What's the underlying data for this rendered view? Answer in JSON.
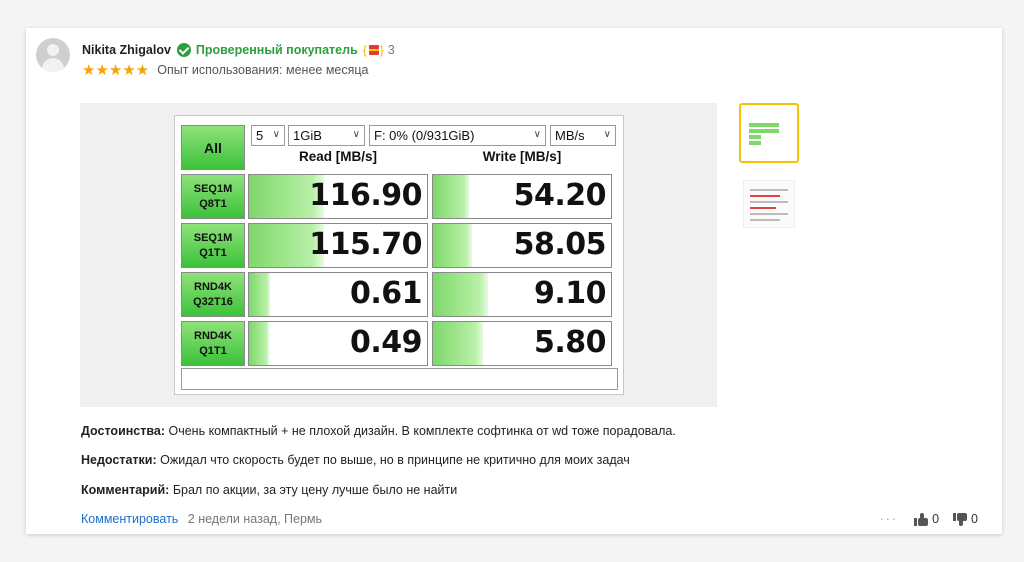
{
  "review": {
    "author": "Nikita Zhigalov",
    "verified_label": "Проверенный покупатель",
    "badge_count": "3",
    "stars": "★★★★★",
    "experience": "Опыт использования: менее месяца",
    "pros_label": "Достоинства:",
    "pros_text": "Очень компактный + не плохой дизайн. В комплекте софтинка от wd тоже порадовала.",
    "cons_label": "Недостатки:",
    "cons_text": "Ожидал что скорость будет по выше, но в принципе не критично для моих задач",
    "comment_label": "Комментарий:",
    "comment_text": "Брал по акции, за эту цену лучше было не найти",
    "comment_link": "Комментировать",
    "meta": "2 недели назад, Пермь",
    "more": "···",
    "likes": "0",
    "dislikes": "0"
  },
  "benchmark": {
    "all_label": "All",
    "count_select": "5",
    "size_select": "1GiB",
    "drive_select": "F: 0% (0/931GiB)",
    "unit_select": "MB/s",
    "read_header": "Read [MB/s]",
    "write_header": "Write [MB/s]",
    "rows": [
      {
        "label1": "SEQ1M",
        "label2": "Q8T1",
        "read": "116.90",
        "write": "54.20",
        "read_fill": 0.42,
        "write_fill": 0.2
      },
      {
        "label1": "SEQ1M",
        "label2": "Q1T1",
        "read": "115.70",
        "write": "58.05",
        "read_fill": 0.42,
        "write_fill": 0.22
      },
      {
        "label1": "RND4K",
        "label2": "Q32T16",
        "read": "0.61",
        "write": "9.10",
        "read_fill": 0.12,
        "write_fill": 0.31
      },
      {
        "label1": "RND4K",
        "label2": "Q1T1",
        "read": "0.49",
        "write": "5.80",
        "read_fill": 0.11,
        "write_fill": 0.28
      }
    ]
  },
  "colors": {
    "verified": "#2e9e3f",
    "link": "#1a6fd1",
    "star": "#f5a300",
    "thumb_selected": "#f5c400",
    "bar_green": "#7ed86a"
  }
}
